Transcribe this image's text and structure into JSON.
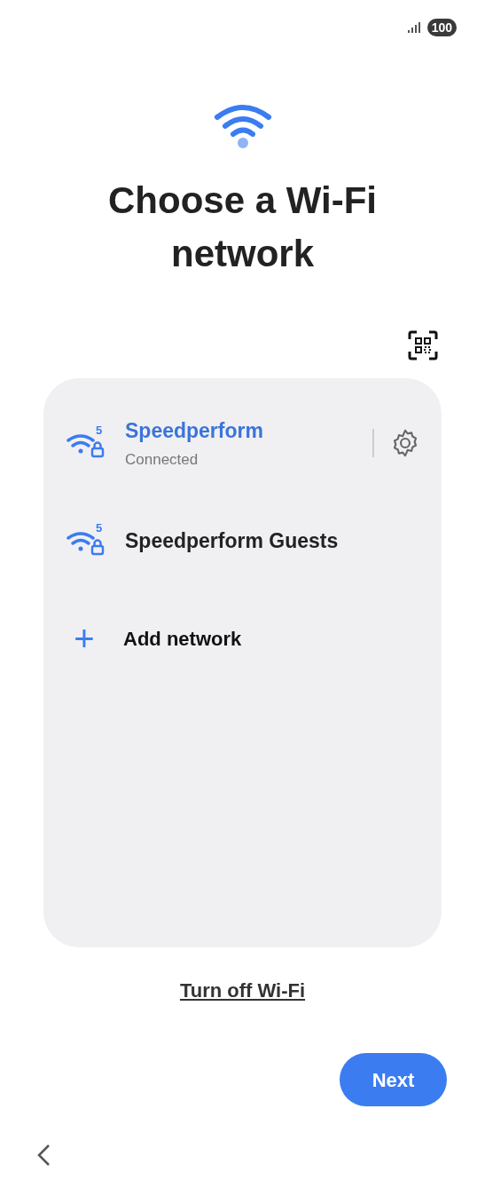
{
  "status_bar": {
    "battery": "100"
  },
  "title": "Choose a Wi-Fi network",
  "networks": [
    {
      "name": "Speedperform",
      "band": "5",
      "status": "Connected",
      "connected": true
    },
    {
      "name": "Speedperform Guests",
      "band": "5",
      "connected": false
    }
  ],
  "add_network": {
    "icon": "+",
    "label": "Add network"
  },
  "turn_off_link": "Turn off Wi-Fi",
  "next_button": "Next"
}
